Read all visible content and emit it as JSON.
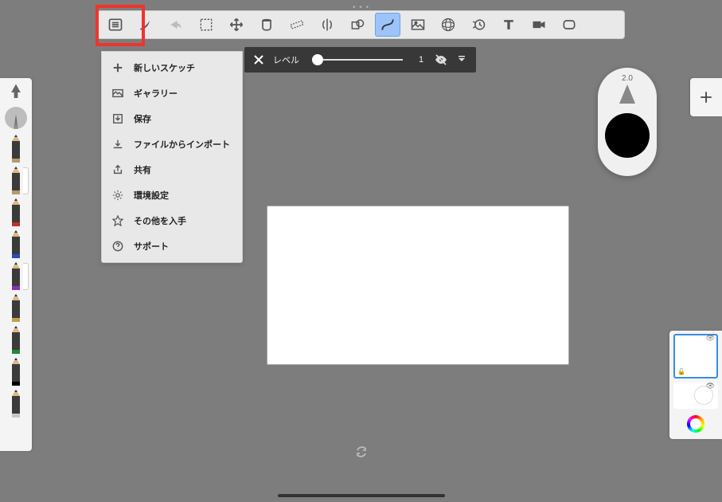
{
  "toolbar": {
    "tools": [
      {
        "name": "menu",
        "icon": "menu"
      },
      {
        "name": "brush",
        "icon": "brush"
      },
      {
        "name": "redo",
        "icon": "redo"
      },
      {
        "name": "select",
        "icon": "select"
      },
      {
        "name": "transform",
        "icon": "transform"
      },
      {
        "name": "fill",
        "icon": "fill"
      },
      {
        "name": "ruler",
        "icon": "ruler"
      },
      {
        "name": "symmetry",
        "icon": "symmetry"
      },
      {
        "name": "shape",
        "icon": "shape"
      },
      {
        "name": "curve",
        "icon": "curve",
        "selected": true
      },
      {
        "name": "image",
        "icon": "image"
      },
      {
        "name": "perspective",
        "icon": "perspective"
      },
      {
        "name": "timelapse",
        "icon": "timelapse"
      },
      {
        "name": "text",
        "icon": "text"
      },
      {
        "name": "camera",
        "icon": "camera"
      },
      {
        "name": "fullscreen",
        "icon": "fullscreen"
      }
    ]
  },
  "menu": {
    "items": [
      {
        "icon": "plus",
        "label": "新しいスケッチ"
      },
      {
        "icon": "gallery",
        "label": "ギャラリー"
      },
      {
        "icon": "save",
        "label": "保存"
      },
      {
        "icon": "import",
        "label": "ファイルからインポート"
      },
      {
        "icon": "share",
        "label": "共有"
      },
      {
        "icon": "gear",
        "label": "環境設定"
      },
      {
        "icon": "star",
        "label": "その他を入手"
      },
      {
        "icon": "help",
        "label": "サポート"
      }
    ]
  },
  "levelBar": {
    "label": "レベル",
    "value": "1"
  },
  "puck": {
    "size": "2.0",
    "color": "#000000"
  },
  "leftRail": {
    "pencils": [
      {
        "band": "#b59a6a",
        "sel": false
      },
      {
        "band": "#b59a6a",
        "sel": true
      },
      {
        "band": "#c1302b",
        "sel": false
      },
      {
        "band": "#2c48c9",
        "sel": false
      },
      {
        "band": "#8a2fbc",
        "sel": true
      },
      {
        "band": "#c4a24a",
        "sel": false
      },
      {
        "band": "#1c8a3a",
        "sel": false
      },
      {
        "band": "#000000",
        "sel": false
      },
      {
        "band": "#c7c7c7",
        "sel": false
      }
    ]
  }
}
